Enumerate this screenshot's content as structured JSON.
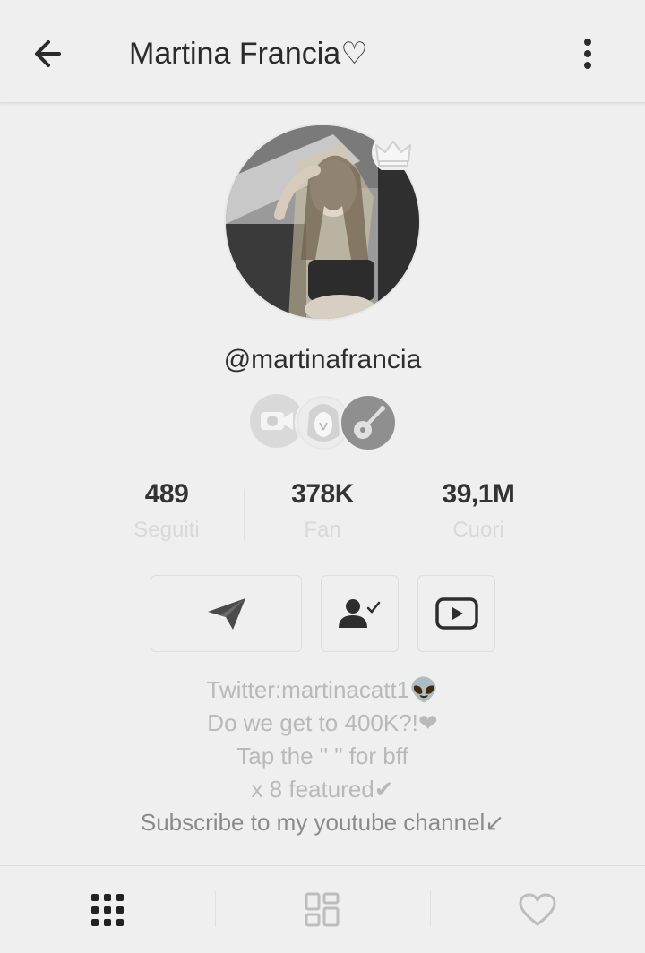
{
  "header": {
    "title": "Martina Francia♡",
    "back_icon": "arrow-left-icon",
    "menu_icon": "more-vertical-icon"
  },
  "profile": {
    "username": "@martinafrancia",
    "badges": [
      "video-camera-badge",
      "avatar-badge",
      "guitar-badge"
    ],
    "has_crown": true
  },
  "stats": [
    {
      "value": "489",
      "label": "Seguiti"
    },
    {
      "value": "378K",
      "label": "Fan"
    },
    {
      "value": "39,1M",
      "label": "Cuori"
    }
  ],
  "actions": {
    "message_icon": "send-icon",
    "follow_icon": "user-check-icon",
    "youtube_icon": "youtube-icon"
  },
  "bio": {
    "line1": "Twitter:martinacatt1👽",
    "line2": "Do we get to 400K?!❤",
    "line3": "Tap the \" \" for bff",
    "line4": "x 8 featured✔",
    "line5": "Subscribe to my youtube channel↙"
  },
  "tabs": [
    "grid-icon",
    "collage-icon",
    "heart-icon"
  ]
}
